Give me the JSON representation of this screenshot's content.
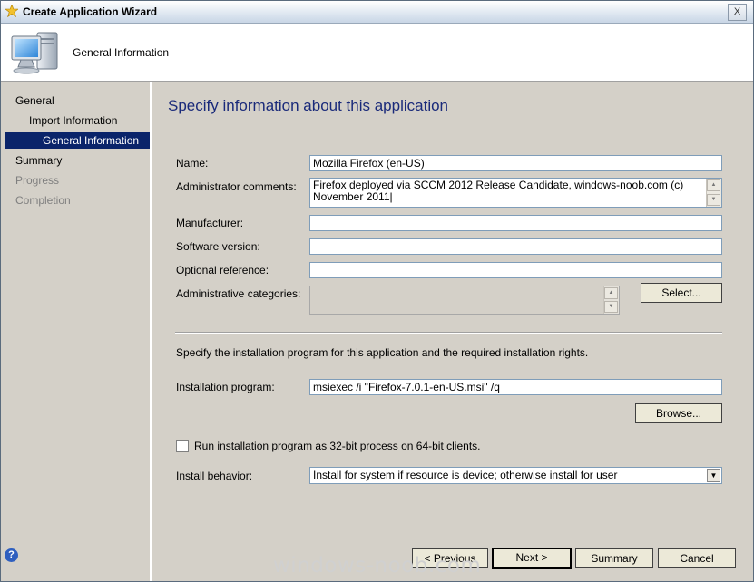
{
  "window": {
    "title": "Create Application Wizard",
    "close_glyph": "X"
  },
  "header": {
    "title": "General Information",
    "icon": "computer-icon"
  },
  "nav": {
    "items": [
      {
        "label": "General",
        "state": "normal"
      },
      {
        "label": "Import Information",
        "state": "normal"
      },
      {
        "label": "General Information",
        "state": "active"
      },
      {
        "label": "Summary",
        "state": "normal"
      },
      {
        "label": "Progress",
        "state": "disabled"
      },
      {
        "label": "Completion",
        "state": "disabled"
      }
    ]
  },
  "page": {
    "heading": "Specify information about this application",
    "fields": {
      "name": {
        "label": "Name:",
        "value": "Mozilla Firefox (en-US)"
      },
      "admin_comments": {
        "label": "Administrator comments:",
        "value": "Firefox deployed via SCCM 2012 Release Candidate, windows-noob.com (c) November 2011|"
      },
      "manufacturer": {
        "label": "Manufacturer:",
        "value": ""
      },
      "software_version": {
        "label": "Software version:",
        "value": ""
      },
      "optional_reference": {
        "label": "Optional reference:",
        "value": ""
      },
      "admin_categories": {
        "label": "Administrative categories:",
        "value": ""
      }
    },
    "select_button": "Select...",
    "install_section_text": "Specify the installation program for this application and the required installation rights.",
    "install_program": {
      "label": "Installation program:",
      "value": "msiexec /i \"Firefox-7.0.1-en-US.msi\" /q"
    },
    "browse_button": "Browse...",
    "checkbox_32bit": {
      "label": "Run installation program as 32-bit process on 64-bit clients.",
      "checked": false
    },
    "install_behavior": {
      "label": "Install behavior:",
      "value": "Install for system if resource is device; otherwise install for user"
    }
  },
  "footer": {
    "help_glyph": "?",
    "previous": "< Previous",
    "next": "Next >",
    "summary": "Summary",
    "cancel": "Cancel"
  },
  "watermark": "windows-noob.com",
  "colors": {
    "active_nav_bg": "#0a246a",
    "heading": "#1a2a7a",
    "dialog_bg": "#d4d0c8"
  }
}
